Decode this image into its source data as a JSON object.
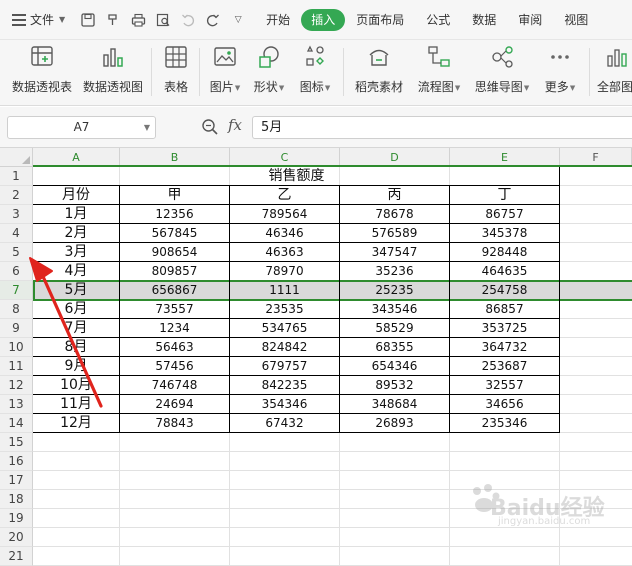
{
  "menu": {
    "file_label": "文件",
    "tabs": [
      "开始",
      "插入",
      "页面布局",
      "公式",
      "数据",
      "审阅",
      "视图"
    ],
    "active_tab": "插入",
    "accent": "#34a853"
  },
  "ribbon": {
    "buttons": [
      {
        "label": "数据透视表",
        "icon": "pivot-table-icon"
      },
      {
        "label": "数据透视图",
        "icon": "pivot-chart-icon"
      },
      {
        "label": "表格",
        "icon": "table-icon"
      },
      {
        "label": "图片",
        "icon": "picture-icon",
        "dropdown": true
      },
      {
        "label": "形状",
        "icon": "shape-icon",
        "dropdown": true
      },
      {
        "label": "图标",
        "icon": "icon-library-icon",
        "dropdown": true
      },
      {
        "label": "稻壳素材",
        "icon": "docer-material-icon"
      },
      {
        "label": "流程图",
        "icon": "flowchart-icon",
        "dropdown": true
      },
      {
        "label": "思维导图",
        "icon": "mindmap-icon",
        "dropdown": true
      },
      {
        "label": "更多",
        "icon": "more-icon",
        "dropdown": true
      },
      {
        "label": "全部图",
        "icon": "all-charts-icon"
      }
    ]
  },
  "formula_bar": {
    "cell_ref": "A7",
    "fx_label": "fx",
    "value": "5月"
  },
  "sheet": {
    "columns": [
      "A",
      "B",
      "C",
      "D",
      "E",
      "F"
    ],
    "rows": [
      "1",
      "2",
      "3",
      "4",
      "5",
      "6",
      "7",
      "8",
      "9",
      "10",
      "11",
      "12",
      "13",
      "14",
      "15",
      "16",
      "17",
      "18",
      "19",
      "20",
      "21"
    ],
    "selected_row": "7",
    "title": "销售额度",
    "headers": [
      "月份",
      "甲",
      "乙",
      "丙",
      "丁"
    ],
    "data": [
      [
        "1月",
        "12356",
        "789564",
        "78678",
        "86757"
      ],
      [
        "2月",
        "567845",
        "46346",
        "576589",
        "345378"
      ],
      [
        "3月",
        "908654",
        "46363",
        "347547",
        "928448"
      ],
      [
        "4月",
        "809857",
        "78970",
        "35236",
        "464635"
      ],
      [
        "5月",
        "656867",
        "1111",
        "25235",
        "254758"
      ],
      [
        "6月",
        "73557",
        "23535",
        "343546",
        "86857"
      ],
      [
        "7月",
        "1234",
        "534765",
        "58529",
        "353725"
      ],
      [
        "8月",
        "56463",
        "824842",
        "68355",
        "364732"
      ],
      [
        "9月",
        "57456",
        "679757",
        "654346",
        "253687"
      ],
      [
        "10月",
        "746748",
        "842235",
        "89532",
        "32557"
      ],
      [
        "11月",
        "24694",
        "354346",
        "348684",
        "34656"
      ],
      [
        "12月",
        "78843",
        "67432",
        "26893",
        "235346"
      ]
    ]
  },
  "watermark": {
    "text": "Baidu经验",
    "sub": "jingyan.baidu.com"
  },
  "colors": {
    "selection_green": "#2e8b2e",
    "arrow_red": "#e0241d"
  }
}
